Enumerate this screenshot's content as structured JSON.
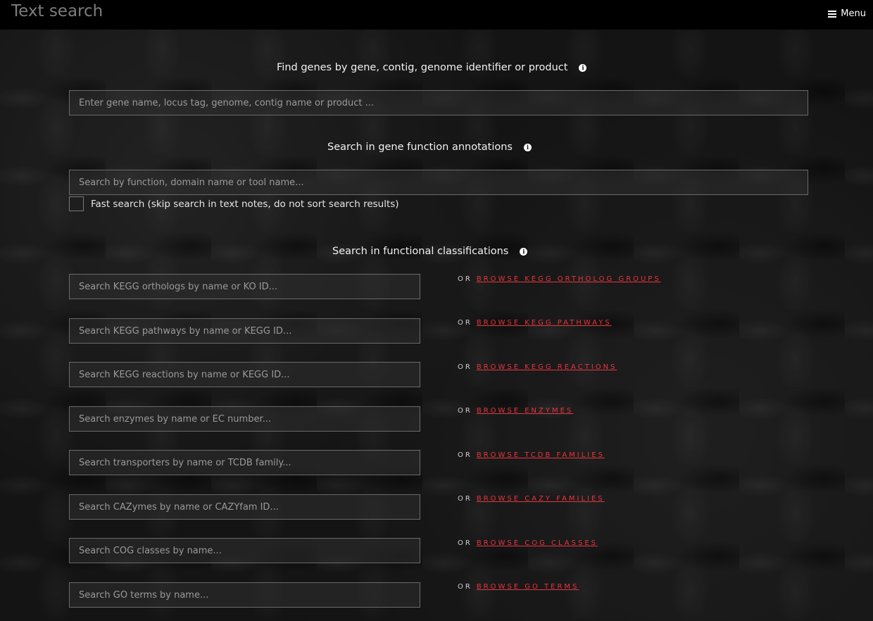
{
  "header": {
    "title": "Text search",
    "menu_label": "Menu"
  },
  "gene_search": {
    "heading": "Find genes by gene, contig, genome identifier or product",
    "placeholder": "Enter gene name, locus tag, genome, contig name or product ..."
  },
  "function_search": {
    "heading": "Search in gene function annotations",
    "placeholder": "Search by function, domain name or tool name...",
    "fast_search_label": "Fast search (skip search in text notes, do not sort search results)"
  },
  "classifications": {
    "heading": "Search in functional classifications",
    "or_label": "OR",
    "items": [
      {
        "placeholder": "Search KEGG orthologs by name or KO ID...",
        "link": "BROWSE KEGG ORTHOLOG GROUPS"
      },
      {
        "placeholder": "Search KEGG pathways by name or KEGG ID...",
        "link": "BROWSE KEGG PATHWAYS"
      },
      {
        "placeholder": "Search KEGG reactions by name or KEGG ID...",
        "link": "BROWSE KEGG REACTIONS"
      },
      {
        "placeholder": "Search enzymes by name or EC number...",
        "link": "BROWSE ENZYMES"
      },
      {
        "placeholder": "Search transporters by name or TCDB family...",
        "link": "BROWSE TCDB FAMILIES"
      },
      {
        "placeholder": "Search CAZymes by name or CAZYfam ID...",
        "link": "BROWSE CAZY FAMILIES"
      },
      {
        "placeholder": "Search COG classes by name...",
        "link": "BROWSE COG CLASSES"
      },
      {
        "placeholder": "Search GO terms by name...",
        "link": "BROWSE GO TERMS"
      }
    ]
  },
  "colors": {
    "link": "#e8343f",
    "topbar": "#000000"
  }
}
